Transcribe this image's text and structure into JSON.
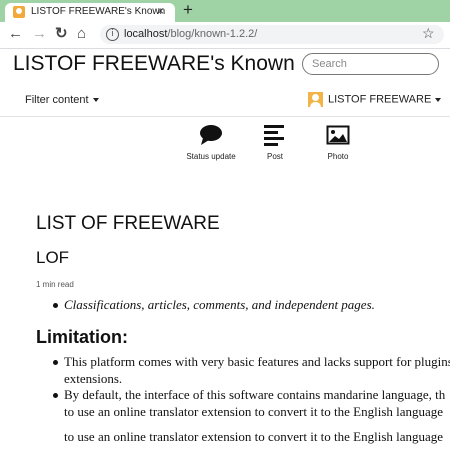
{
  "browser": {
    "tab_title": "LISTOF FREEWARE's Known",
    "tab_close": "×",
    "new_tab": "+",
    "url_host": "localhost",
    "url_path": "/blog/known-1.2.2/",
    "info": "i",
    "back": "←",
    "forward": "→",
    "reload": "↻",
    "home": "⌂",
    "star": "☆"
  },
  "site": {
    "title": "LISTOF FREEWARE's Known",
    "search_placeholder": "Search",
    "filter_label": "Filter content",
    "user_name": "LISTOF FREEWARE"
  },
  "actions": [
    {
      "label": "Status update",
      "icon": "speech-bubble-icon"
    },
    {
      "label": "Post",
      "icon": "lines-icon"
    },
    {
      "label": "Photo",
      "icon": "image-icon"
    }
  ],
  "article": {
    "title": "LIST OF FREEWARE",
    "subtitle": "LOF",
    "read_time": "1 min read",
    "bullet1": "Classifications, articles, comments, and independent pages.",
    "limitation_heading": "Limitation:",
    "lim1_line1": "This platform comes with very basic features and lacks support for plugins",
    "lim1_line2": "extensions.",
    "lim2_line1": "By default, the interface of this software contains mandarine language, th",
    "lim2_line2": "to use an online translator extension to convert it to the English language",
    "repeat_line": "to use an online translator extension to convert it to the English language"
  }
}
